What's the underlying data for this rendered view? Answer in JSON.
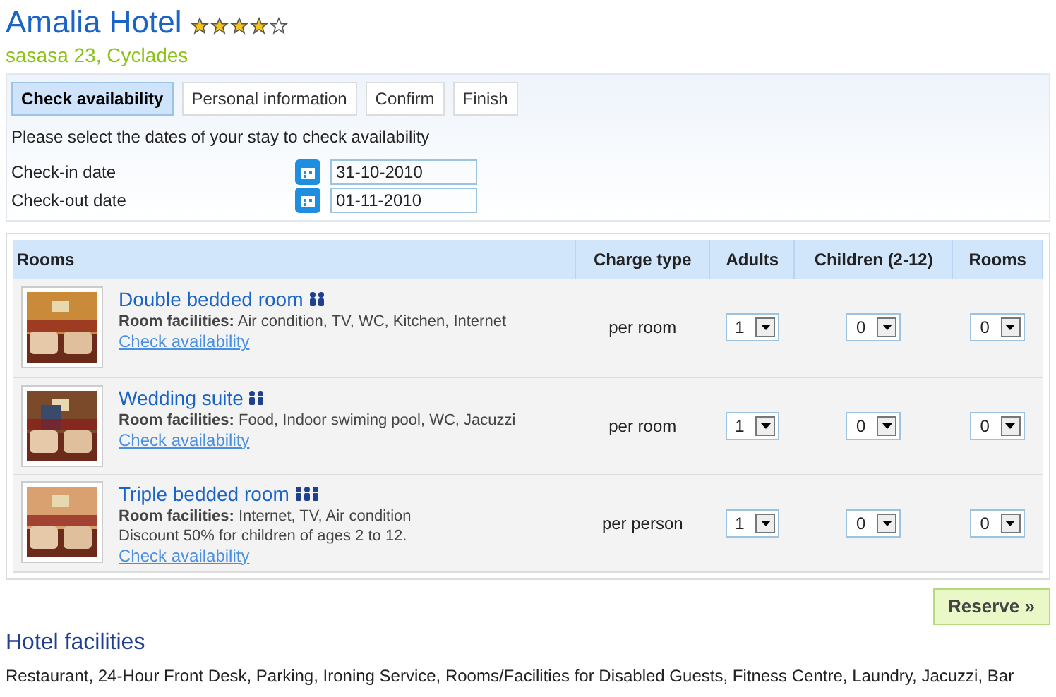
{
  "hotel": {
    "name": "Amalia Hotel",
    "stars": 4,
    "address": "sasasa 23, Cyclades"
  },
  "steps": [
    {
      "label": "Check availability",
      "selected": true
    },
    {
      "label": "Personal information",
      "selected": false
    },
    {
      "label": "Confirm",
      "selected": false
    },
    {
      "label": "Finish",
      "selected": false
    }
  ],
  "instructions": "Please select the dates of your stay to check availability",
  "dates": [
    {
      "label": "Check-in date",
      "value": "31-10-2010"
    },
    {
      "label": "Check-out date",
      "value": "01-11-2010"
    }
  ],
  "table": {
    "columns": [
      "Rooms",
      "Charge type",
      "Adults",
      "Children (2-12)",
      "Rooms"
    ],
    "rows": [
      {
        "name": "Double bedded room",
        "kind": "two-person",
        "facilities_label": "Room facilities:",
        "facilities": "Air condition, TV, WC, Kitchen, Internet",
        "link": "Check availability",
        "charge_type": "per room",
        "adults": "1",
        "children": "0",
        "rooms": "0"
      },
      {
        "name": "Wedding suite",
        "kind": "two-person",
        "facilities_label": "Room facilities:",
        "facilities": "Food, Indoor swiming pool, WC, Jacuzzi",
        "link": "Check availability",
        "charge_type": "per room",
        "adults": "1",
        "children": "0",
        "rooms": "0"
      },
      {
        "name": "Triple bedded room",
        "kind": "three-person",
        "facilities_label": "Room facilities:",
        "facilities": "Internet, TV, Air condition",
        "note": "Discount 50% for children of ages 2 to 12.",
        "link": "Check availability",
        "charge_type": "per person",
        "adults": "1",
        "children": "0",
        "rooms": "0"
      }
    ]
  },
  "reserve_button": "Reserve »",
  "hotel_facilities": {
    "title": "Hotel facilities",
    "text": "Restaurant, 24-Hour Front Desk, Parking, Ironing Service, Rooms/Facilities for Disabled Guests, Fitness Centre, Laundry, Jacuzzi, Bar"
  }
}
